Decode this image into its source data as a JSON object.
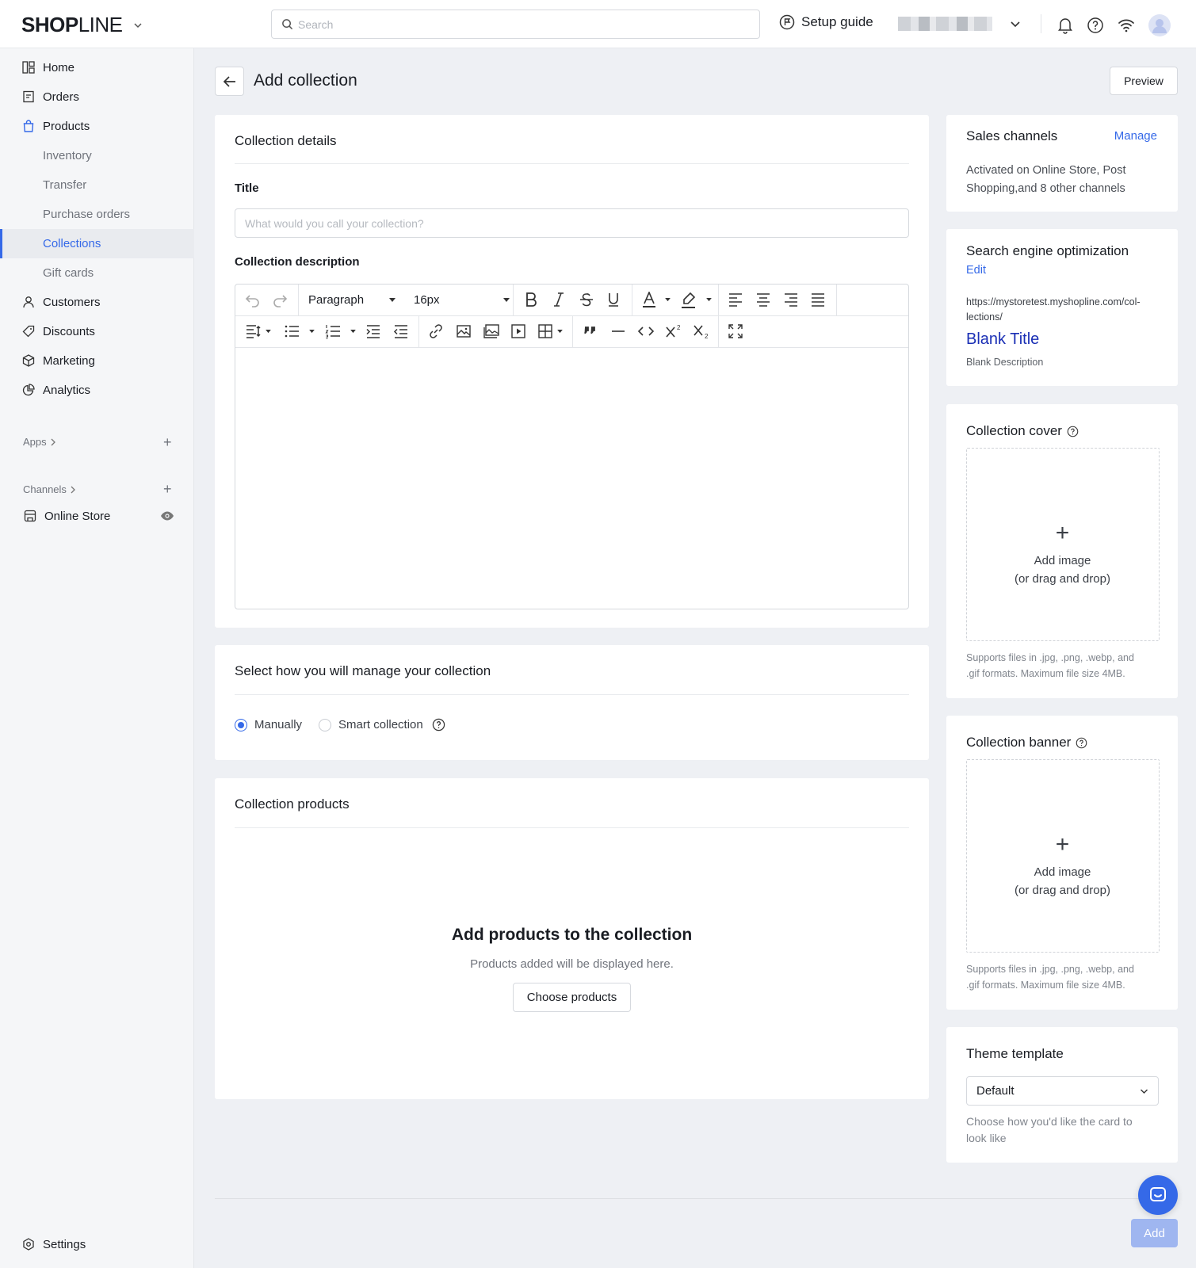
{
  "topbar": {
    "logo_bold": "SHOP",
    "logo_light": "LINE",
    "search_placeholder": "Search",
    "setup_guide": "Setup guide"
  },
  "sidebar": {
    "items": [
      {
        "label": "Home",
        "icon": "home-icon"
      },
      {
        "label": "Orders",
        "icon": "orders-icon"
      },
      {
        "label": "Products",
        "icon": "bag-icon"
      },
      {
        "label": "Inventory"
      },
      {
        "label": "Transfer"
      },
      {
        "label": "Purchase orders"
      },
      {
        "label": "Collections"
      },
      {
        "label": "Gift cards"
      },
      {
        "label": "Customers",
        "icon": "person-icon"
      },
      {
        "label": "Discounts",
        "icon": "tag-icon"
      },
      {
        "label": "Marketing",
        "icon": "cube-icon"
      },
      {
        "label": "Analytics",
        "icon": "pie-icon"
      }
    ],
    "apps_label": "Apps",
    "channels_label": "Channels",
    "online_store": "Online Store",
    "settings": "Settings"
  },
  "page": {
    "title": "Add collection",
    "preview": "Preview"
  },
  "details": {
    "heading": "Collection details",
    "title_label": "Title",
    "title_value": "",
    "title_placeholder": "What would you call your collection?",
    "description_label": "Collection description",
    "paragraph_select": "Paragraph",
    "font_size_select": "16px"
  },
  "manage": {
    "heading": "Select how you will manage your collection",
    "option_manual": "Manually",
    "option_smart": "Smart collection",
    "selected": "Manually"
  },
  "products": {
    "heading": "Collection products",
    "empty_title": "Add products to the collection",
    "empty_sub": "Products added will be displayed here.",
    "choose_button": "Choose products"
  },
  "sales_channels": {
    "heading": "Sales channels",
    "manage_link": "Manage",
    "line1": "Activated on Online Store, Post",
    "line2": "Shopping,and 8 other channels"
  },
  "seo": {
    "heading": "Search engine optimization",
    "edit_link": "Edit",
    "url_line1": "https://mystoretest.myshopline.com/col-",
    "url_line2": "lections/",
    "preview_title": "Blank Title",
    "preview_description": "Blank Description"
  },
  "cover": {
    "heading": "Collection cover",
    "add_image": "Add image",
    "drag_drop": "(or drag and drop)",
    "hint_line1": "Supports files in .jpg, .png, .webp, and",
    "hint_line2": ".gif formats. Maximum file size 4MB."
  },
  "banner": {
    "heading": "Collection banner",
    "add_image": "Add image",
    "drag_drop": "(or drag and drop)",
    "hint_line1": "Supports files in .jpg, .png, .webp, and",
    "hint_line2": ".gif formats. Maximum file size 4MB."
  },
  "theme": {
    "heading": "Theme template",
    "selected": "Default",
    "hint_line1": "Choose how you'd like the card to",
    "hint_line2": "look like"
  },
  "footer": {
    "add_button": "Add"
  },
  "colors": {
    "accent": "#3569e8",
    "seo_title": "#1a2fb5",
    "disabled_button": "#9fb6f0"
  }
}
